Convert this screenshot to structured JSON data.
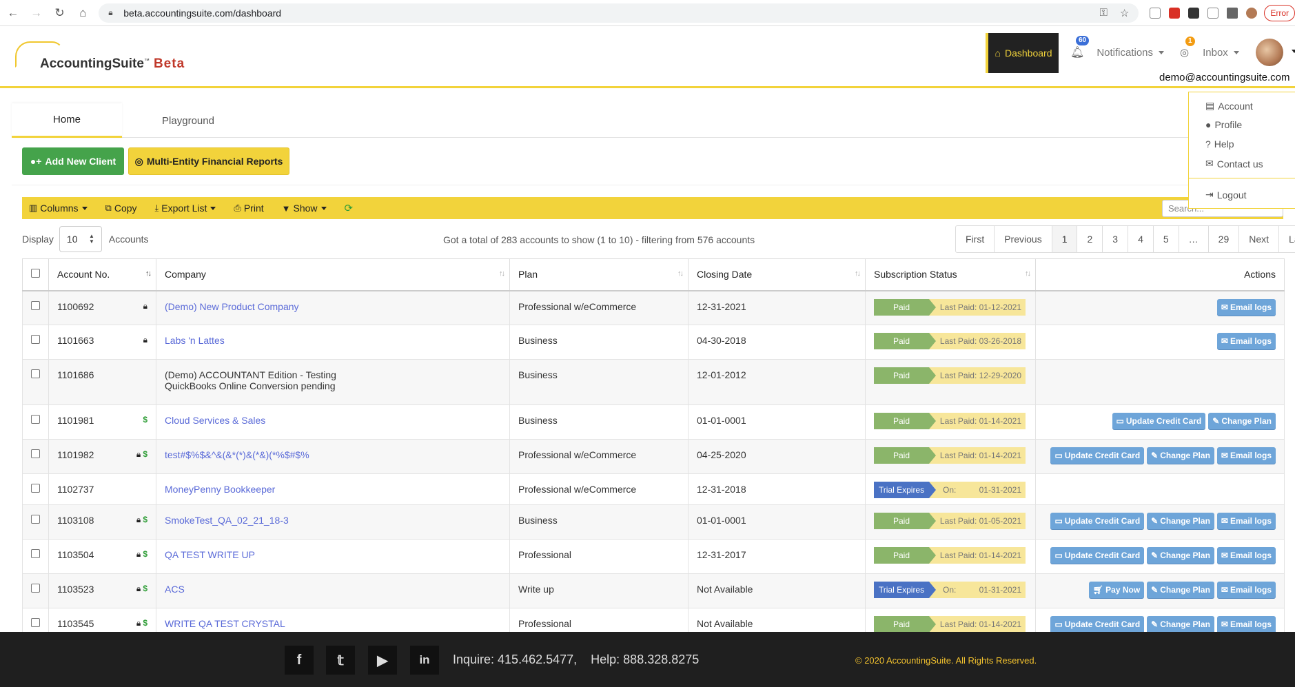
{
  "browser": {
    "url": "beta.accountingsuite.com/dashboard",
    "error_label": "Error"
  },
  "header": {
    "brand": "AccountingSuite",
    "brand_tm": "™",
    "brand_beta": "Beta",
    "dashboard_label": "Dashboard",
    "notifications_label": "Notifications",
    "notifications_count": "60",
    "inbox_label": "Inbox",
    "inbox_count": "1",
    "user_email": "demo@accountingsuite.com"
  },
  "user_menu": {
    "account": "Account",
    "profile": "Profile",
    "help": "Help",
    "contact": "Contact us",
    "logout": "Logout"
  },
  "tabs": [
    {
      "label": "Home",
      "active": true
    },
    {
      "label": "Playground",
      "active": false
    }
  ],
  "actions": {
    "add_client": "Add New Client",
    "multi_entity": "Multi-Entity Financial Reports"
  },
  "toolbar": {
    "columns": "Columns",
    "copy": "Copy",
    "export": "Export List",
    "print": "Print",
    "show": "Show",
    "search_placeholder": "Search..."
  },
  "listing": {
    "display_label": "Display",
    "display_value": "10",
    "accounts_label": "Accounts",
    "summary": "Got a total of 283 accounts to show (1 to 10) - filtering from 576 accounts"
  },
  "pagination": [
    "First",
    "Previous",
    "1",
    "2",
    "3",
    "4",
    "5",
    "…",
    "29",
    "Next",
    "Last"
  ],
  "table": {
    "headers": {
      "account_no": "Account No.",
      "company": "Company",
      "plan": "Plan",
      "closing_date": "Closing Date",
      "subscription_status": "Subscription Status",
      "actions": "Actions"
    },
    "rows": [
      {
        "acct": "1100692",
        "lock": true,
        "dollar": false,
        "company": "(Demo) New Product Company",
        "link": true,
        "plan": "Professional w/eCommerce",
        "date": "12-31-2021",
        "status": "Paid",
        "status_type": "paid",
        "status_info": "Last Paid: 01-12-2021",
        "info_on": "",
        "buttons": [
          "Email logs"
        ]
      },
      {
        "acct": "1101663",
        "lock": true,
        "dollar": false,
        "company": "Labs 'n Lattes",
        "link": true,
        "plan": "Business",
        "date": "04-30-2018",
        "status": "Paid",
        "status_type": "paid",
        "status_info": "Last Paid: 03-26-2018",
        "info_on": "",
        "buttons": [
          "Email logs"
        ]
      },
      {
        "acct": "1101686",
        "lock": false,
        "dollar": false,
        "company": "(Demo) ACCOUNTANT Edition - Testing",
        "company2": "QuickBooks Online Conversion pending",
        "link": false,
        "plan": "Business",
        "date": "12-01-2012",
        "status": "Paid",
        "status_type": "paid",
        "status_info": "Last Paid: 12-29-2020",
        "info_on": "",
        "buttons": []
      },
      {
        "acct": "1101981",
        "lock": false,
        "dollar": true,
        "company": "Cloud Services & Sales",
        "link": true,
        "plan": "Business",
        "date": "01-01-0001",
        "status": "Paid",
        "status_type": "paid",
        "status_info": "Last Paid: 01-14-2021",
        "info_on": "",
        "buttons": [
          "Update Credit Card",
          "Change Plan"
        ]
      },
      {
        "acct": "1101982",
        "lock": true,
        "dollar": true,
        "company": "test#$%$&^&(&*(*)&(*&)(*%$#$%",
        "link": true,
        "plan": "Professional w/eCommerce",
        "date": "04-25-2020",
        "status": "Paid",
        "status_type": "paid",
        "status_info": "Last Paid: 01-14-2021",
        "info_on": "",
        "buttons": [
          "Update Credit Card",
          "Change Plan",
          "Email logs"
        ]
      },
      {
        "acct": "1102737",
        "lock": false,
        "dollar": false,
        "company": "MoneyPenny Bookkeeper",
        "link": true,
        "plan": "Professional w/eCommerce",
        "date": "12-31-2018",
        "status": "Trial Expires",
        "status_type": "trial",
        "status_info": "01-31-2021",
        "info_on": "On:",
        "buttons": []
      },
      {
        "acct": "1103108",
        "lock": true,
        "dollar": true,
        "company": "SmokeTest_QA_02_21_18-3",
        "link": true,
        "plan": "Business",
        "date": "01-01-0001",
        "status": "Paid",
        "status_type": "paid",
        "status_info": "Last Paid: 01-05-2021",
        "info_on": "",
        "buttons": [
          "Update Credit Card",
          "Change Plan",
          "Email logs"
        ]
      },
      {
        "acct": "1103504",
        "lock": true,
        "dollar": true,
        "company": "QA TEST WRITE UP",
        "link": true,
        "plan": "Professional",
        "date": "12-31-2017",
        "status": "Paid",
        "status_type": "paid",
        "status_info": "Last Paid: 01-14-2021",
        "info_on": "",
        "buttons": [
          "Update Credit Card",
          "Change Plan",
          "Email logs"
        ]
      },
      {
        "acct": "1103523",
        "lock": true,
        "dollar": true,
        "company": "ACS",
        "link": true,
        "plan": "Write up",
        "date": "Not Available",
        "status": "Trial Expires",
        "status_type": "trial",
        "status_info": "01-31-2021",
        "info_on": "On:",
        "buttons": [
          "Pay Now",
          "Change Plan",
          "Email logs"
        ]
      },
      {
        "acct": "1103545",
        "lock": true,
        "dollar": true,
        "company": "WRITE QA TEST CRYSTAL",
        "link": true,
        "plan": "Professional",
        "date": "Not Available",
        "status": "Paid",
        "status_type": "paid",
        "status_info": "Last Paid: 01-14-2021",
        "info_on": "",
        "buttons": [
          "Update Credit Card",
          "Change Plan",
          "Email logs"
        ]
      }
    ]
  },
  "footer": {
    "social": [
      "f",
      "t",
      "yt",
      "in"
    ],
    "contact": "Inquire: 415.462.5477,    Help: 888.328.8275",
    "copyright": "© 2020 AccountingSuite. All Rights Reserved."
  },
  "colors": {
    "accent_yellow": "#f2d33b",
    "green": "#45a34b",
    "link_blue": "#5a6ad8",
    "paid_green": "#8bb56a",
    "trial_blue": "#4a72c4",
    "action_blue": "#6ea5d9"
  }
}
